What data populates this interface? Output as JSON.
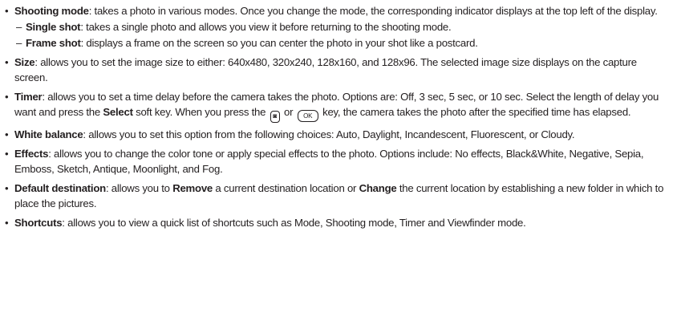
{
  "bullet_glyph": "•",
  "dash_glyph": "–",
  "items": {
    "shooting_mode": {
      "term": "Shooting mode",
      "text": ": takes a photo in various modes. Once you change the mode, the corresponding indicator displays at the top left of the display.",
      "subs": [
        {
          "term": "Single shot",
          "text": ": takes a single photo and allows you view it before returning to the shooting mode."
        },
        {
          "term": "Frame shot",
          "text": ": displays a frame on the screen so you can center the photo in your shot like a postcard."
        }
      ]
    },
    "size": {
      "term": "Size",
      "text": ": allows you to set the image size to either: 640x480, 320x240, 128x160, and 128x96. The selected image size displays on the capture screen."
    },
    "timer": {
      "term": "Timer",
      "text_1": ": allows you to set a time delay before the camera takes the photo. Options are: Off, 3 sec, 5 sec, or 10 sec. Select the length of delay you want and press the ",
      "select_label": "Select",
      "text_2": " soft key. When you press the ",
      "camera_key_glyph": "◙",
      "or_text": " or ",
      "ok_key_label": "OK",
      "text_3": " key, the camera takes the photo after the specified time has elapsed."
    },
    "white_balance": {
      "term": "White balance",
      "text": ": allows you to set this option from the following choices: Auto, Daylight, Incandescent, Fluorescent, or Cloudy."
    },
    "effects": {
      "term": "Effects",
      "text": ": allows you to change the color tone or apply special effects to the photo. Options include: No effects, Black&White, Negative, Sepia, Emboss, Sketch, Antique, Moonlight, and Fog."
    },
    "default_destination": {
      "term": "Default destination",
      "text_1": ": allows you to ",
      "remove_label": "Remove",
      "text_2": " a current destination location or ",
      "change_label": "Change",
      "text_3": " the current location by establishing a new folder in which to place the pictures."
    },
    "shortcuts": {
      "term": "Shortcuts",
      "text": ": allows you to view a quick list of shortcuts such as Mode, Shooting mode, Timer and Viewfinder mode."
    }
  }
}
